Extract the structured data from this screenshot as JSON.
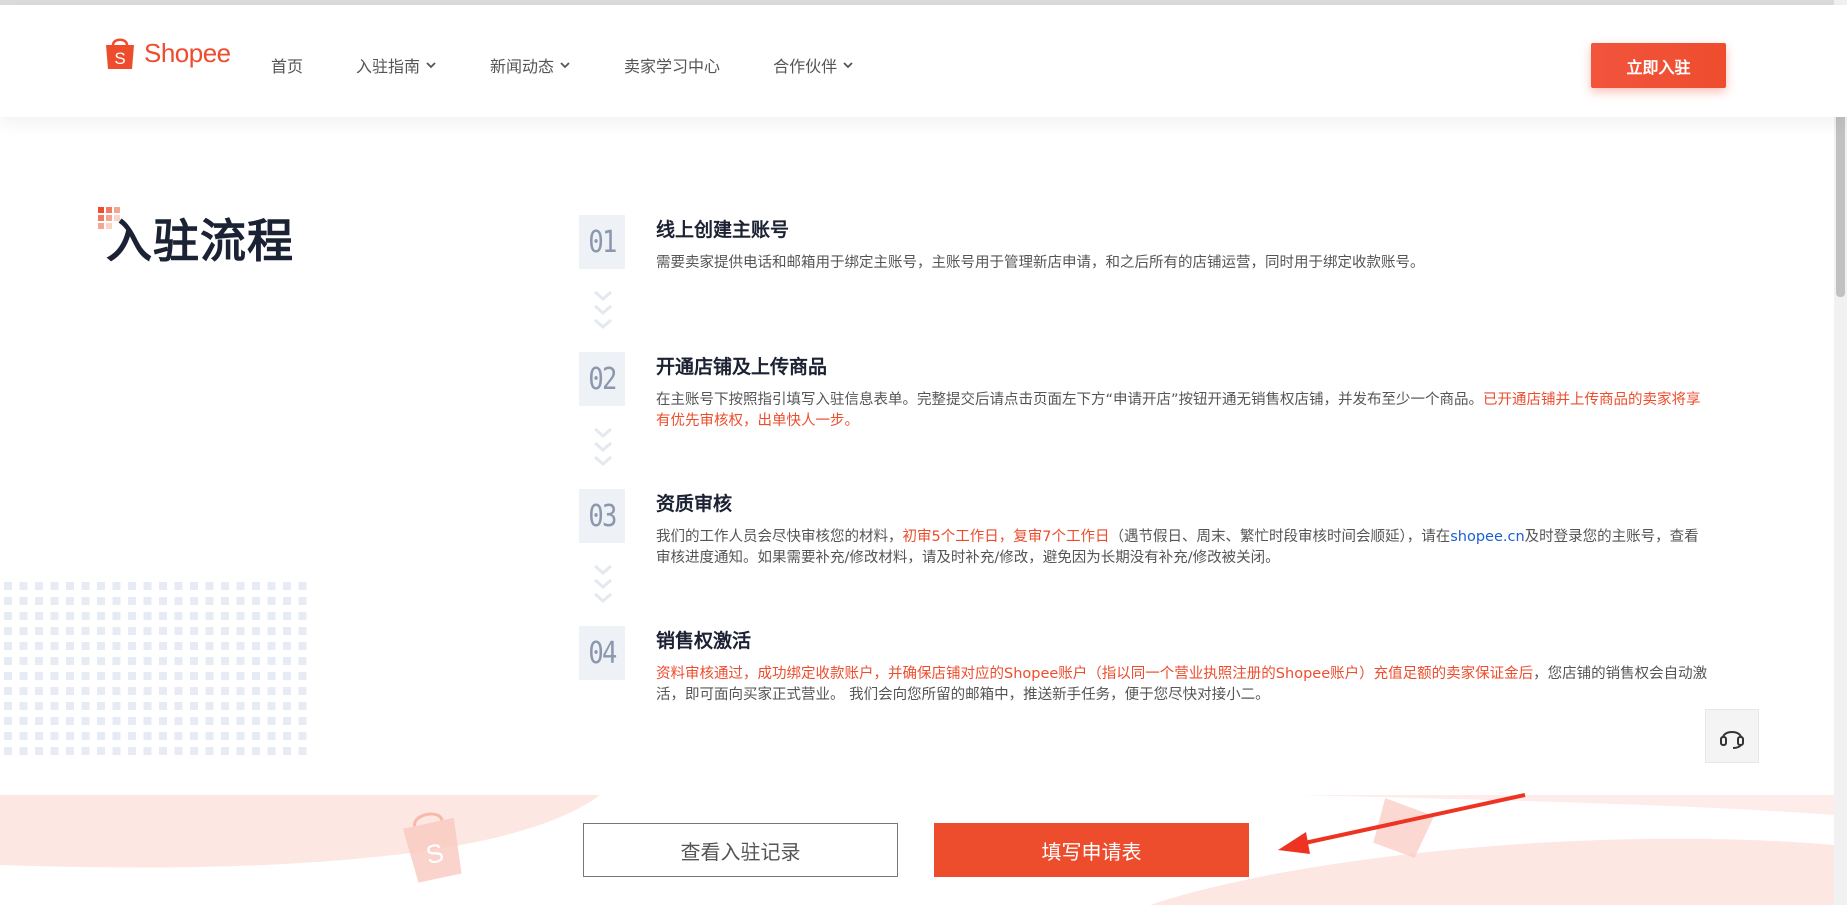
{
  "header": {
    "logo_text": "Shopee",
    "nav": [
      {
        "label": "首页",
        "has_dropdown": false
      },
      {
        "label": "入驻指南",
        "has_dropdown": true
      },
      {
        "label": "新闻动态",
        "has_dropdown": true
      },
      {
        "label": "卖家学习中心",
        "has_dropdown": false
      },
      {
        "label": "合作伙伴",
        "has_dropdown": true
      }
    ],
    "cta_label": "立即入驻"
  },
  "section": {
    "title": "入驻流程"
  },
  "steps": [
    {
      "num": "01",
      "title": "线上创建主账号",
      "desc": "需要卖家提供电话和邮箱用于绑定主账号，主账号用于管理新店申请，和之后所有的店铺运营，同时用于绑定收款账号。"
    },
    {
      "num": "02",
      "title": "开通店铺及上传商品",
      "desc_a": "在主账号下按照指引填写入驻信息表单。完整提交后请点击页面左下方“申请开店”按钮开通无销售权店铺，并发布至少一个商品。",
      "desc_red": "已开通店铺并上传商品的卖家将享有优先审核权，出单快人一步。"
    },
    {
      "num": "03",
      "title": "资质审核",
      "desc_a": "我们的工作人员会尽快审核您的材料，",
      "desc_red": "初审5个工作日，复审7个工作日",
      "desc_b": "（遇节假日、周末、繁忙时段审核时间会顺延），请在",
      "desc_link": "shopee.cn",
      "desc_c": "及时登录您的主账号，查看审核进度通知。如果需要补充/修改材料，请及时补充/修改，避免因为长期没有补充/修改被关闭。"
    },
    {
      "num": "04",
      "title": "销售权激活",
      "desc_red": "资料审核通过，成功绑定收款账户，并确保店铺对应的Shopee账户（指以同一个营业执照注册的Shopee账户）充值足额的卖家保证金后",
      "desc_b": "，您店铺的销售权会自动激活，即可面向买家正式营业。 我们会向您所留的邮箱中，推送新手任务，便于您尽快对接小二。"
    }
  ],
  "actions": {
    "record_label": "查看入驻记录",
    "apply_label": "填写申请表"
  },
  "colors": {
    "brand": "#ee4d2d",
    "link": "#1a5fd6",
    "title": "#1a2233"
  }
}
